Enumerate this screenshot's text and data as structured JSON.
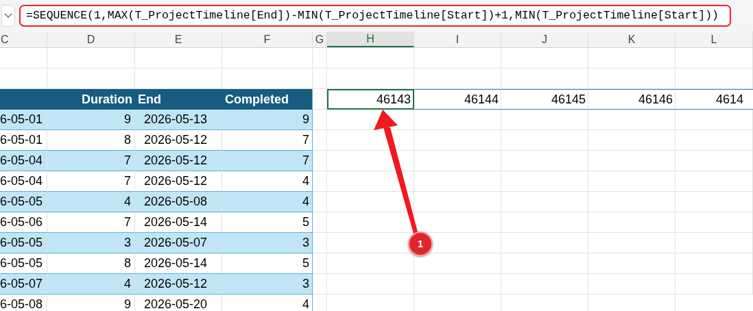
{
  "formula_bar": {
    "formula": "=SEQUENCE(1,MAX(T_ProjectTimeline[End])-MIN(T_ProjectTimeline[Start])+1,MIN(T_ProjectTimeline[Start]))"
  },
  "column_headers": [
    {
      "label": "C",
      "selected": false
    },
    {
      "label": "D",
      "selected": false
    },
    {
      "label": "E",
      "selected": false
    },
    {
      "label": "F",
      "selected": false
    },
    {
      "label": "G",
      "selected": false
    },
    {
      "label": "H",
      "selected": true
    },
    {
      "label": "I",
      "selected": false
    },
    {
      "label": "J",
      "selected": false
    },
    {
      "label": "K",
      "selected": false
    },
    {
      "label": "L",
      "selected": false
    }
  ],
  "table": {
    "columns": [
      "Duration",
      "End",
      "Completed"
    ],
    "rows": [
      {
        "start": "6-05-01",
        "duration": "9",
        "end": "2026-05-13",
        "completed": "9"
      },
      {
        "start": "6-05-01",
        "duration": "8",
        "end": "2026-05-12",
        "completed": "7"
      },
      {
        "start": "6-05-04",
        "duration": "7",
        "end": "2026-05-12",
        "completed": "7"
      },
      {
        "start": "6-05-04",
        "duration": "7",
        "end": "2026-05-12",
        "completed": "4"
      },
      {
        "start": "6-05-05",
        "duration": "4",
        "end": "2026-05-08",
        "completed": "4"
      },
      {
        "start": "6-05-06",
        "duration": "7",
        "end": "2026-05-14",
        "completed": "5"
      },
      {
        "start": "6-05-05",
        "duration": "3",
        "end": "2026-05-07",
        "completed": "3"
      },
      {
        "start": "6-05-05",
        "duration": "8",
        "end": "2026-05-14",
        "completed": "5"
      },
      {
        "start": "6-05-07",
        "duration": "4",
        "end": "2026-05-12",
        "completed": "3"
      },
      {
        "start": "6-05-08",
        "duration": "9",
        "end": "2026-05-20",
        "completed": "4"
      }
    ]
  },
  "spill_cells": [
    {
      "value": "46143",
      "selected": true
    },
    {
      "value": "46144",
      "selected": false
    },
    {
      "value": "46145",
      "selected": false
    },
    {
      "value": "46146",
      "selected": false
    },
    {
      "value": "4614",
      "selected": false
    }
  ],
  "callout": {
    "label": "1"
  }
}
